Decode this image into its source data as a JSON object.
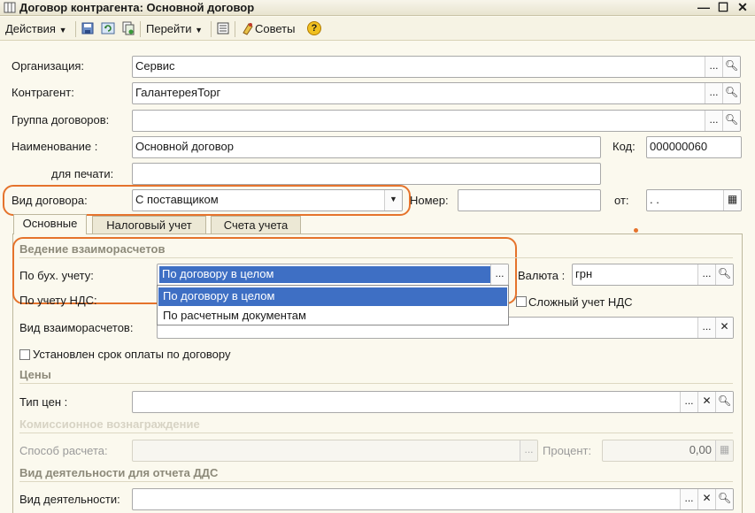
{
  "window": {
    "title": "Договор контрагента: Основной договор",
    "controls": {
      "minimize": "—",
      "maximize": "☐",
      "close": "✕"
    }
  },
  "toolbar": {
    "actions_label": "Действия",
    "goto_label": "Перейти",
    "tips_label": "Советы",
    "help_glyph": "?"
  },
  "form": {
    "organization": {
      "label": "Организация:",
      "value": "Сервис"
    },
    "counterparty": {
      "label": "Контрагент:",
      "value": "ГалантереяТорг"
    },
    "contract_group": {
      "label": "Группа договоров:",
      "value": ""
    },
    "name": {
      "label": "Наименование :",
      "value": "Основной договор"
    },
    "code": {
      "label": "Код:",
      "value": "000000060"
    },
    "print_name": {
      "label": "для печати:",
      "value": ""
    },
    "contract_type": {
      "label": "Вид договора:",
      "value": "С поставщиком"
    },
    "number": {
      "label": "Номер:",
      "value": ""
    },
    "date": {
      "label": "от:",
      "value": " .  ."
    }
  },
  "tabs": [
    {
      "label": "Основные",
      "active": true
    },
    {
      "label": "Налоговый учет",
      "active": false
    },
    {
      "label": "Счета учета",
      "active": false
    }
  ],
  "settlements": {
    "section_title": "Ведение взаиморасчетов",
    "accounting": {
      "label": "По бух. учету:",
      "value": "По договору в целом"
    },
    "currency": {
      "label": "Валюта :",
      "value": "грн"
    },
    "vat": {
      "label": "По учету НДС:"
    },
    "complex_vat": {
      "label": "Сложный  учет НДС",
      "checked": false
    },
    "dropdown_options": [
      {
        "label": "По договору в целом",
        "selected": true
      },
      {
        "label": "По расчетным документам",
        "selected": false
      }
    ],
    "settlement_type": {
      "label": "Вид взаиморасчетов:",
      "value": ""
    },
    "payment_term": {
      "label": "Установлен срок оплаты по договору",
      "checked": false
    }
  },
  "prices": {
    "section_title": "Цены",
    "price_type": {
      "label": "Тип цен :",
      "value": ""
    }
  },
  "commission": {
    "section_title": "Комиссионное вознаграждение",
    "calc_method": {
      "label": "Способ расчета:",
      "value": ""
    },
    "percent": {
      "label": "Процент:",
      "value": "0,00"
    }
  },
  "dds": {
    "section_title": "Вид деятельности для отчета ДДС",
    "activity": {
      "label": "Вид деятельности:",
      "value": ""
    }
  },
  "buttons": {
    "ellipsis": "...",
    "clear": "✕",
    "dropdown_arrow": "▼"
  },
  "colors": {
    "accent_highlight": "#e5732c",
    "selection": "#3e6fc4",
    "background": "#fbf9ee"
  }
}
